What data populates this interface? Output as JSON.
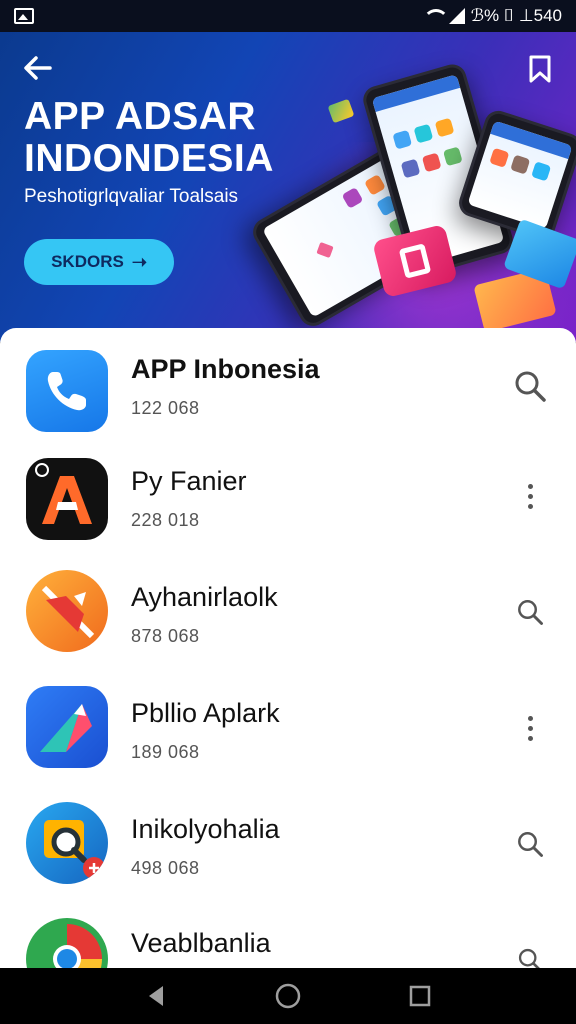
{
  "status_bar": {
    "text": "ℬ% ⌷ ⊥540"
  },
  "hero": {
    "title": "APP ADSAR INDONDESIA",
    "subtitle": "Peshotigrlqvaliar Toalsais",
    "button_label": "SKDORS",
    "button_arrow": "➝"
  },
  "apps": [
    {
      "name": "APP Inbonesia",
      "count": "122 068",
      "action": "search-icon"
    },
    {
      "name": "Py Fanier",
      "count": "228 018",
      "action": "more-vert-icon"
    },
    {
      "name": "Ayhanirlaolk",
      "count": "878 068",
      "action": "search-icon"
    },
    {
      "name": "Pbllio Aplark",
      "count": "189 068",
      "action": "more-vert-icon"
    },
    {
      "name": "Inikolyohalia",
      "count": "498 068",
      "action": "search-icon"
    },
    {
      "name": "Veablbanlia",
      "count": "",
      "action": "search-icon"
    }
  ],
  "colors": {
    "hero_gradient_start": "#0b3a8f",
    "hero_gradient_end": "#7a22c9",
    "accent_button": "#35c6f4",
    "phone_icon_blue": "#1e88f5"
  }
}
